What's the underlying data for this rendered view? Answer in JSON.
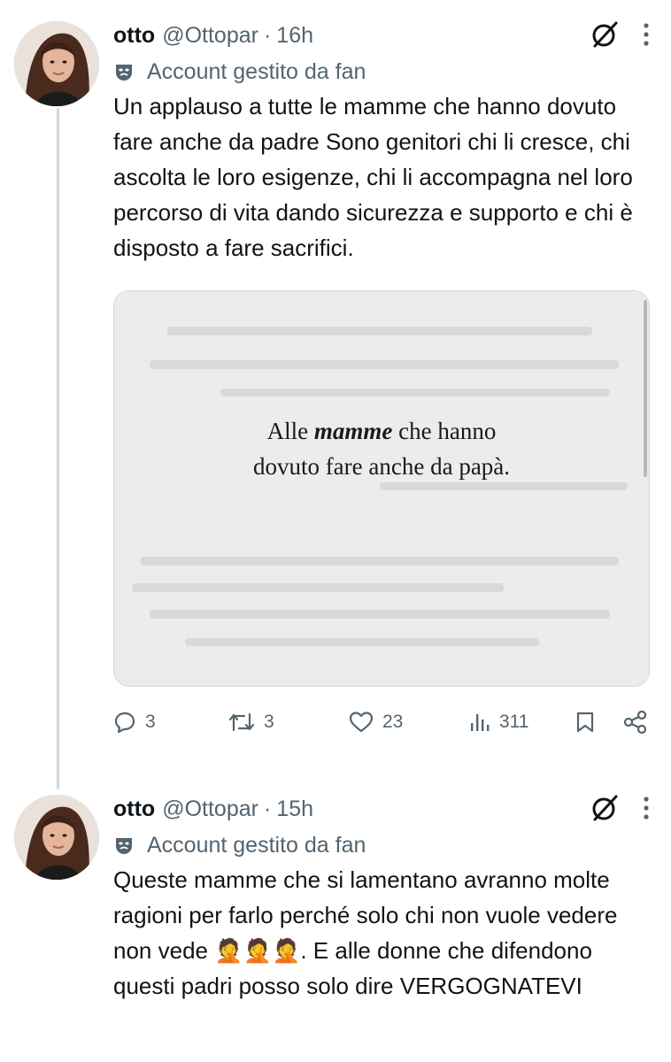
{
  "tweets": [
    {
      "name": "otto",
      "handle": "@Ottopar",
      "separator": "·",
      "time": "16h",
      "fan_label": "Account gestito da fan",
      "text": "Un applauso a tutte le mamme che hanno dovuto fare anche da padre Sono genitori chi li cresce, chi ascolta le loro esigenze, chi li accompagna nel loro percorso di vita dando sicurezza e supporto e chi è disposto a fare sacrifici.",
      "media": {
        "line1_before": "Alle ",
        "line1_emph": "mamme",
        "line1_after": " che hanno",
        "line2": "dovuto fare anche da papà."
      },
      "actions": {
        "replies": "3",
        "reposts": "3",
        "likes": "23",
        "views": "311"
      }
    },
    {
      "name": "otto",
      "handle": "@Ottopar",
      "separator": "·",
      "time": "15h",
      "fan_label": "Account gestito da fan",
      "text_before_emoji": "Queste mamme che si lamentano avranno molte ragioni per farlo perché solo chi non vuole vedere non vede ",
      "emoji": "🤦🤦🤦",
      "text_after_emoji": ". E alle donne che difendono questi padri posso solo dire VERGOGNATEVI"
    }
  ],
  "icons": {
    "header": [
      "grok-icon",
      "more-icon"
    ],
    "fan": "mask-icon",
    "actions": [
      "reply-icon",
      "repost-icon",
      "like-icon",
      "views-icon",
      "bookmark-icon",
      "share-icon"
    ]
  },
  "colors": {
    "text": "#0f1419",
    "secondary": "#536471",
    "thread_line": "#cfd9de"
  }
}
